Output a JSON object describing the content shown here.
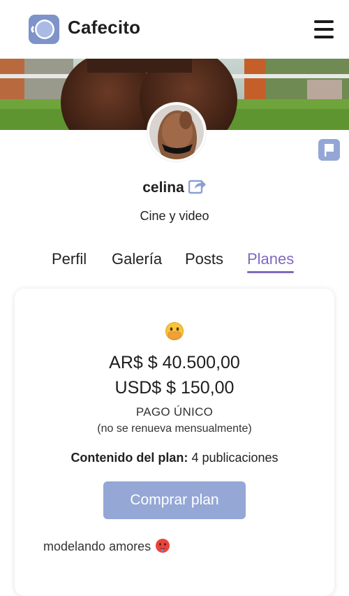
{
  "header": {
    "brand": "Cafecito",
    "logo_icon": "coffee-cup-logo-icon",
    "menu_icon": "hamburger-menu-icon"
  },
  "profile": {
    "username": "celina",
    "share_icon": "share-icon",
    "category": "Cine y video",
    "report_icon": "flag-icon"
  },
  "tabs": [
    {
      "label": "Perfil",
      "active": false
    },
    {
      "label": "Galería",
      "active": false
    },
    {
      "label": "Posts",
      "active": false
    },
    {
      "label": "Planes",
      "active": true
    }
  ],
  "plan": {
    "emoji_icon": "face-with-hand-over-mouth-emoji",
    "price_ars": "AR$ $ 40.500,00",
    "price_usd": "USD$ $ 150,00",
    "payment_type": "PAGO ÚNICO",
    "renewal_note": "(no se renueva mensualmente)",
    "content_label": "Contenido del plan:",
    "content_value": "4 publicaciones",
    "buy_label": "Comprar plan",
    "description": "modelando amores",
    "description_emoji": "hot-face-emoji"
  },
  "colors": {
    "accent": "#8069c0",
    "button": "#94a7d5",
    "flag": "#94a6d6"
  }
}
